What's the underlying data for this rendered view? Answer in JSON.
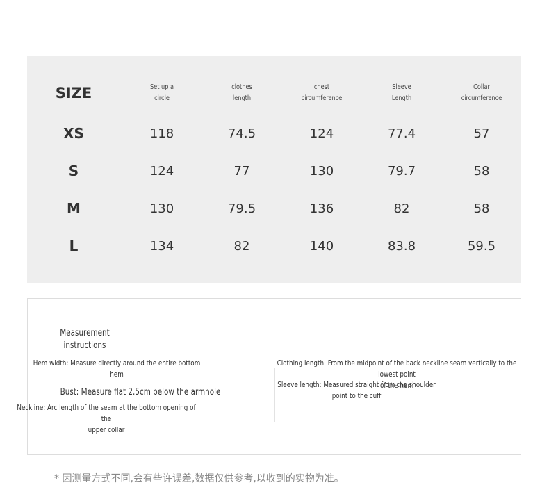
{
  "size_table": {
    "size_header": "SIZE",
    "headers": [
      "Set up a\ncircle",
      "clothes\nlength",
      "chest\ncircumference",
      "Sleeve\nLength",
      "Collar\ncircumference"
    ],
    "rows": [
      {
        "size": "XS",
        "values": [
          "118",
          "74.5",
          "124",
          "77.4",
          "57"
        ]
      },
      {
        "size": "S",
        "values": [
          "124",
          "77",
          "130",
          "79.7",
          "58"
        ]
      },
      {
        "size": "M",
        "values": [
          "130",
          "79.5",
          "136",
          "82",
          "58"
        ]
      },
      {
        "size": "L",
        "values": [
          "134",
          "82",
          "140",
          "83.8",
          "59.5"
        ]
      }
    ]
  },
  "instructions": {
    "title": "Measurement\ninstructions",
    "hem": "Hem width: Measure directly around the entire bottom\nhem",
    "bust": "Bust: Measure flat 2.5cm below the armhole",
    "neckline": "Neckline: Arc length of the seam at the bottom opening of the\nupper collar",
    "clothing_length": "Clothing length: From the midpoint of the back neckline seam vertically to the lowest point\nof the hem",
    "sleeve_length": "Sleeve length: Measured straight from the shoulder\npoint to the cuff"
  },
  "footnote": "* 因测量方式不同,会有些许误差,数据仅供参考,以收到的实物为准。"
}
